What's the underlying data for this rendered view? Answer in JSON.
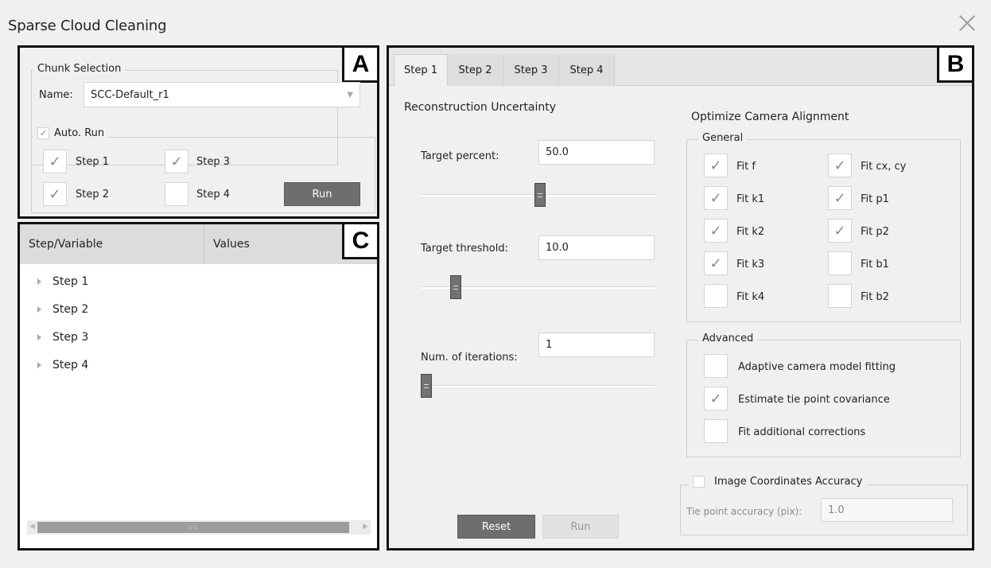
{
  "window": {
    "title": "Sparse Cloud Cleaning"
  },
  "panel_a": {
    "letter": "A",
    "chunk_group": "Chunk Selection",
    "name_label": "Name:",
    "name_value": "SCC-Default_r1",
    "auto_run": {
      "label": "Auto. Run",
      "checked": true
    },
    "steps": [
      {
        "label": "Step 1",
        "checked": true
      },
      {
        "label": "Step 3",
        "checked": true
      },
      {
        "label": "Step 2",
        "checked": true
      },
      {
        "label": "Step 4",
        "checked": false
      }
    ],
    "run_label": "Run"
  },
  "panel_c": {
    "letter": "C",
    "columns": [
      "Step/Variable",
      "Values"
    ],
    "items": [
      "Step 1",
      "Step 2",
      "Step 3",
      "Step 4"
    ],
    "scrollbar_grip": "IIII"
  },
  "panel_b": {
    "letter": "B",
    "tabs": [
      "Step 1",
      "Step 2",
      "Step 3",
      "Step 4"
    ],
    "active_tab": "Step 1",
    "recon_title": "Reconstruction Uncertainty",
    "params": [
      {
        "label": "Target percent:",
        "value": "50.0",
        "slider_fraction": 0.51
      },
      {
        "label": "Target threshold:",
        "value": "10.0",
        "slider_fraction": 0.13
      },
      {
        "label": "Num. of iterations:",
        "value": "1",
        "slider_fraction": 0.0
      }
    ],
    "reset_label": "Reset",
    "run_label": "Run",
    "optimize_title": "Optimize Camera Alignment",
    "general_group": "General",
    "general_items": [
      {
        "label": "Fit f",
        "checked": true
      },
      {
        "label": "Fit cx, cy",
        "checked": true
      },
      {
        "label": "Fit k1",
        "checked": true
      },
      {
        "label": "Fit p1",
        "checked": true
      },
      {
        "label": "Fit k2",
        "checked": true
      },
      {
        "label": "Fit p2",
        "checked": true
      },
      {
        "label": "Fit k3",
        "checked": true
      },
      {
        "label": "Fit b1",
        "checked": false
      },
      {
        "label": "Fit k4",
        "checked": false
      },
      {
        "label": "Fit b2",
        "checked": false
      }
    ],
    "advanced_group": "Advanced",
    "advanced_items": [
      {
        "label": "Adaptive camera model fitting",
        "checked": false
      },
      {
        "label": "Estimate tie point covariance",
        "checked": true
      },
      {
        "label": "Fit additional corrections",
        "checked": false
      }
    ],
    "image_coords": {
      "label": "Image Coordinates Accuracy",
      "checked": false,
      "tie_label": "Tie point accuracy (pix):",
      "tie_value": "1.0"
    }
  },
  "icons": {
    "check": "checkmark-icon",
    "close": "close-icon",
    "expand": "expand-triangle-icon",
    "dropdown": "dropdown-arrow-icon"
  }
}
